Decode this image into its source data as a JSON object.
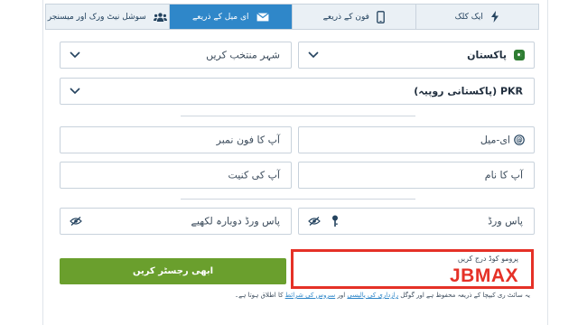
{
  "tabs": [
    {
      "label": "ایک کلک",
      "icon": "lightning-icon",
      "active": false
    },
    {
      "label": "فون کے ذریعے",
      "icon": "phone-icon",
      "active": false
    },
    {
      "label": "ای میل کے ذریعے",
      "icon": "envelope-icon",
      "active": true
    },
    {
      "label": "سوشل نیٹ ورک اور میسنجر",
      "icon": "users-icon",
      "active": false
    }
  ],
  "form": {
    "country": "پاکستان",
    "city_placeholder": "شہر منتخب کریں",
    "currency": "PKR (پاکستانی روپیہ)",
    "email_placeholder": "ای-میل",
    "phone_placeholder": "آپ کا فون نمبر",
    "name_placeholder": "آپ کا نام",
    "surname_placeholder": "آپ کی کنیت",
    "password_placeholder": "پاس ورڈ",
    "password_repeat_placeholder": "پاس ورڈ دوبارہ لکھیے"
  },
  "promo": {
    "label": "پرومو کوڈ درج کریں",
    "code": "JBMAX"
  },
  "register_label": "ابھی رجسٹر کریں",
  "terms": {
    "prefix": "یہ سائٹ ری کیپچا کے ذریعہ محفوظ ہے اور گوگل",
    "privacy_link": "رازداری کی پالیسی",
    "and": "اور",
    "service_link": "سروس کی شرائط",
    "suffix": "کا اطلاق ہوتا ہے۔"
  },
  "colors": {
    "tab_active": "#2f87c9",
    "register_button": "#6a9f2d",
    "promo_highlight": "#e53127"
  }
}
